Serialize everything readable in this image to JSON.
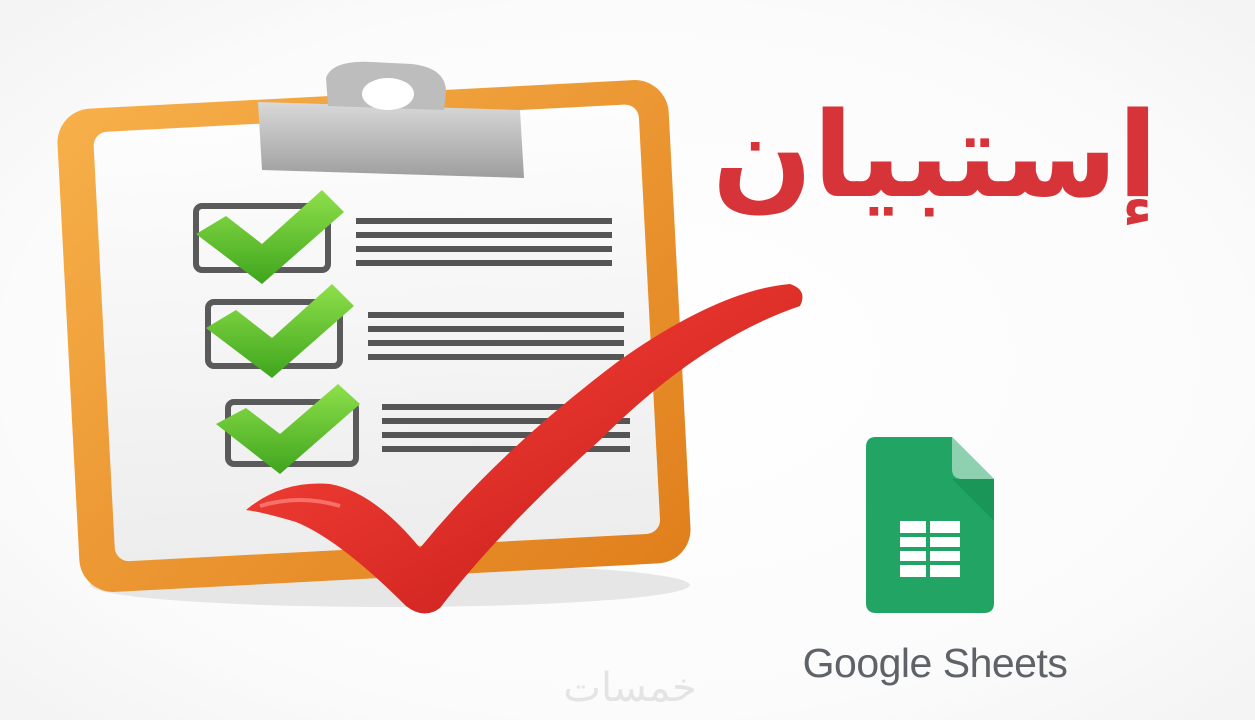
{
  "headline": "إستبيان",
  "brand": {
    "label": "Google Sheets",
    "logo_icon": "google-sheets-icon"
  },
  "watermark": "خمسات",
  "illustration": {
    "icons": [
      "clipboard-icon",
      "checkbox-checked-icon",
      "red-checkmark-icon"
    ],
    "checklist_items": 3
  },
  "colors": {
    "headline": "#d63438",
    "clipboard_frame": "#f0922e",
    "check_green": "#5cbf2a",
    "big_check_red": "#e02424",
    "sheets_green": "#21a464",
    "sheets_fold": "#8ed1b0",
    "brand_text": "#5f6368"
  }
}
